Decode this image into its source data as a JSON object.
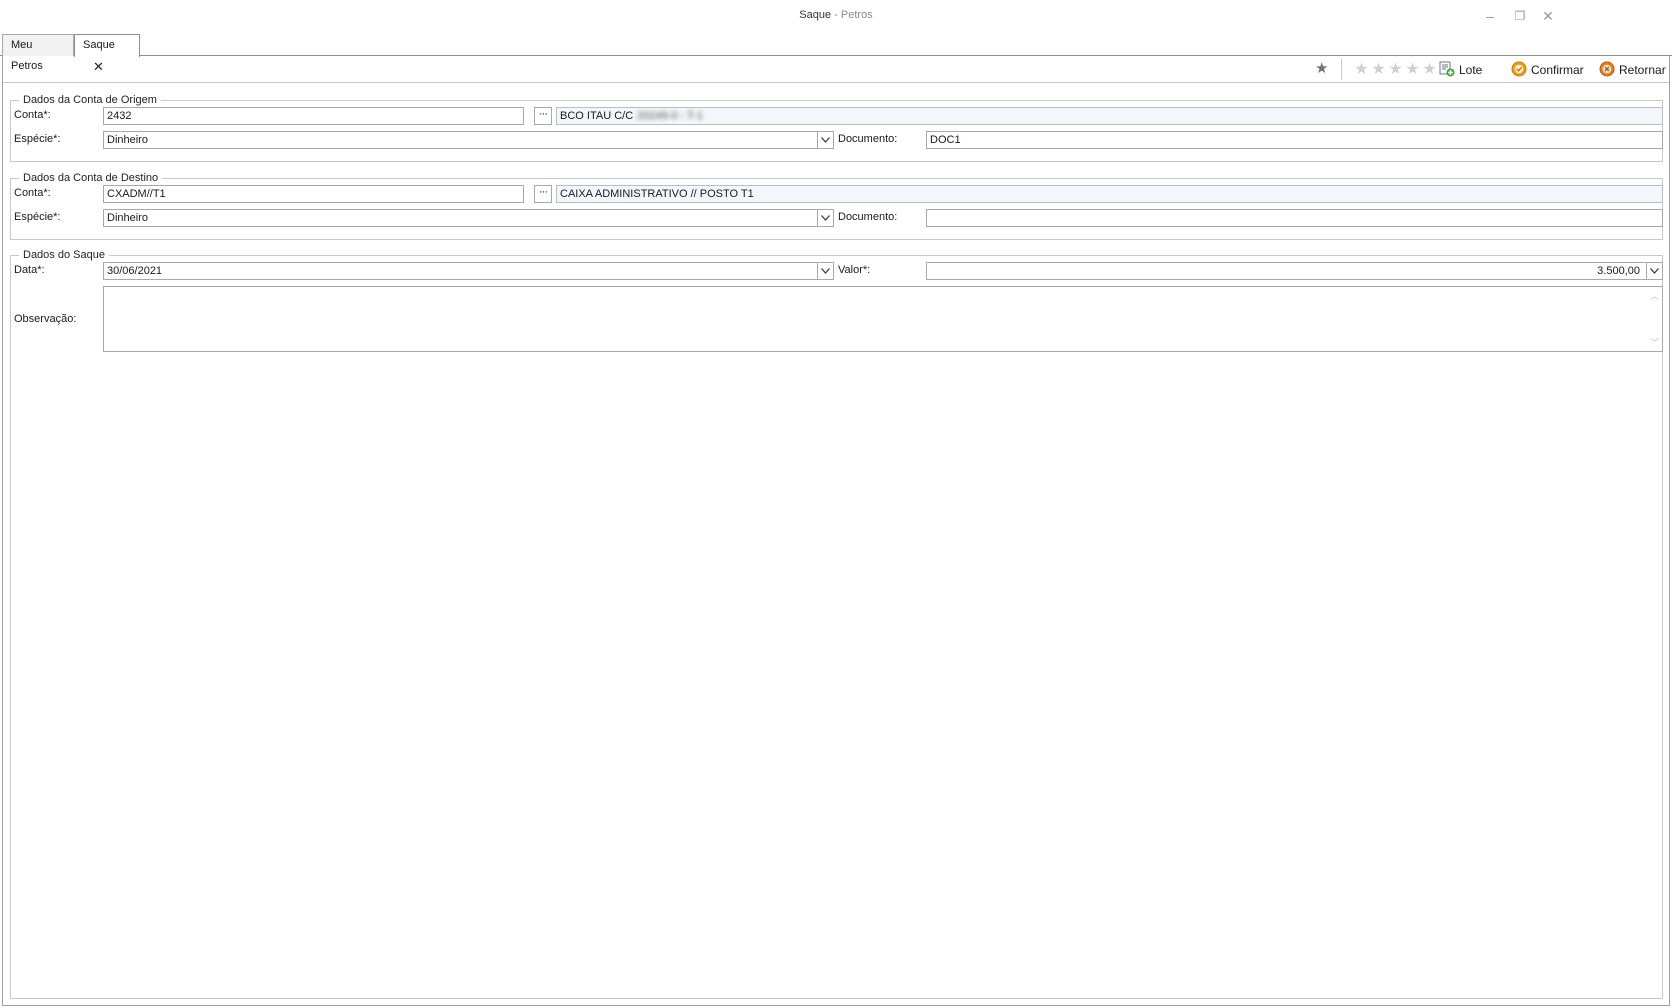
{
  "window": {
    "title_main": "Saque",
    "title_sep": " - ",
    "title_app": "Petros",
    "min_glyph": "–",
    "restore_glyph": "❐",
    "close_glyph": "✕"
  },
  "tabs": [
    {
      "label": "Meu Petros",
      "active": false
    },
    {
      "label": "Saque",
      "active": true,
      "close_glyph": "✕"
    }
  ],
  "toolbar": {
    "favorite_glyph": "★",
    "rating_glyph": "★",
    "rating_value": 0,
    "rating_max": 5,
    "lote_label": "Lote",
    "confirmar_label": "Confirmar",
    "retornar_label": "Retornar",
    "colors": {
      "confirm": "#f39c12",
      "return": "#e67e22",
      "lote_plus": "#3aa53a"
    }
  },
  "origem": {
    "group_title": "Dados da Conta de Origem",
    "conta_label": "Conta*:",
    "conta_value": "2432",
    "conta_desc": "BCO ITAU C/C",
    "conta_desc_masked": "20249-0 - T-1",
    "especie_label": "Espécie*:",
    "especie_value": "Dinheiro",
    "documento_label": "Documento:",
    "documento_value": "DOC1"
  },
  "destino": {
    "group_title": "Dados da Conta de Destino",
    "conta_label": "Conta*:",
    "conta_value": "CXADM//T1",
    "conta_desc": "CAIXA ADMINISTRATIVO // POSTO T1",
    "especie_label": "Espécie*:",
    "especie_value": "Dinheiro",
    "documento_label": "Documento:",
    "documento_value": ""
  },
  "saque": {
    "group_title": "Dados do Saque",
    "data_label": "Data*:",
    "data_value": "30/06/2021",
    "valor_label": "Valor*:",
    "valor_value": "3.500,00",
    "observacao_label": "Observação:",
    "observacao_value": ""
  },
  "ellipsis_glyph": "···",
  "scroll_up_glyph": "︿",
  "scroll_down_glyph": "﹀"
}
